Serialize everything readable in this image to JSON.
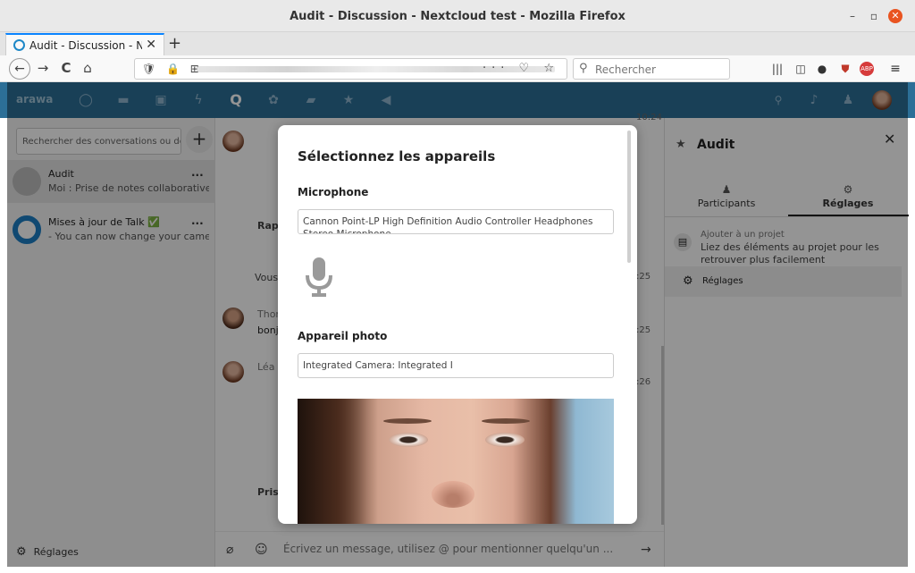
{
  "window": {
    "title": "Audit - Discussion - Nextcloud test - Mozilla Firefox",
    "minimize": "–",
    "maximize": "▫",
    "close": "✕"
  },
  "tabs": [
    {
      "label": "Audit - Discussion - Nextcloud",
      "close": "✕"
    }
  ],
  "newtab_label": "+",
  "navbar": {
    "back": "←",
    "forward": "→",
    "reload": "C",
    "home": "⌂",
    "url_icons": "🛡 🔒 ⊞",
    "url_actions": "··· ♡ ☆",
    "search_placeholder": "Rechercher"
  },
  "nc_header": {
    "logo": "arawa",
    "apps": [
      "files-app",
      "photos-app",
      "activity-app",
      "talk-app",
      "circles-app",
      "deck-app",
      "favorites-app",
      "announcements-app"
    ]
  },
  "conversations": {
    "search_placeholder": "Rechercher des conversations ou de",
    "new_button": "+",
    "items": [
      {
        "name": "Audit",
        "last_message": "Moi : Prise de notes collaborative...",
        "more": "...",
        "active": true
      },
      {
        "name": "Mises à jour de Talk ✅",
        "last_message": "- You can now change your camer...",
        "more": "...",
        "active": false
      }
    ],
    "settings_label": "Réglages"
  },
  "chat": {
    "fragments": [
      {
        "text": "Rapp",
        "bold": true
      },
      {
        "text": "Vous",
        "bold": false
      },
      {
        "text": "Thor",
        "bold": false
      },
      {
        "text": "bonj",
        "bold": false
      },
      {
        "text": "Léa I",
        "bold": false
      },
      {
        "text": "Prise",
        "bold": true
      }
    ],
    "times": [
      "10:24",
      ":25",
      ":25",
      ":26"
    ],
    "input_placeholder": "Écrivez un message, utilisez @ pour mentionner quelqu'un ...",
    "send": "→"
  },
  "right_sidebar": {
    "title": "Audit",
    "close": "✕",
    "tabs": [
      {
        "label": "Participants",
        "active": false
      },
      {
        "label": "Réglages",
        "active": true
      }
    ],
    "project_heading": "Ajouter à un projet",
    "project_description": "Liez des éléments au projet pour les retrouver plus facilement",
    "settings_label": "Réglages"
  },
  "modal": {
    "title": "Sélectionnez les appareils",
    "microphone_label": "Microphone",
    "microphone_value": "Cannon Point-LP High Definition Audio Controller Headphones Stereo Microphone",
    "camera_label": "Appareil photo",
    "camera_value": "Integrated Camera: Integrated I"
  },
  "colors": {
    "nc_header": "#2c6f97",
    "accent_tab": "#0a84ff",
    "close_button": "#e95420"
  }
}
